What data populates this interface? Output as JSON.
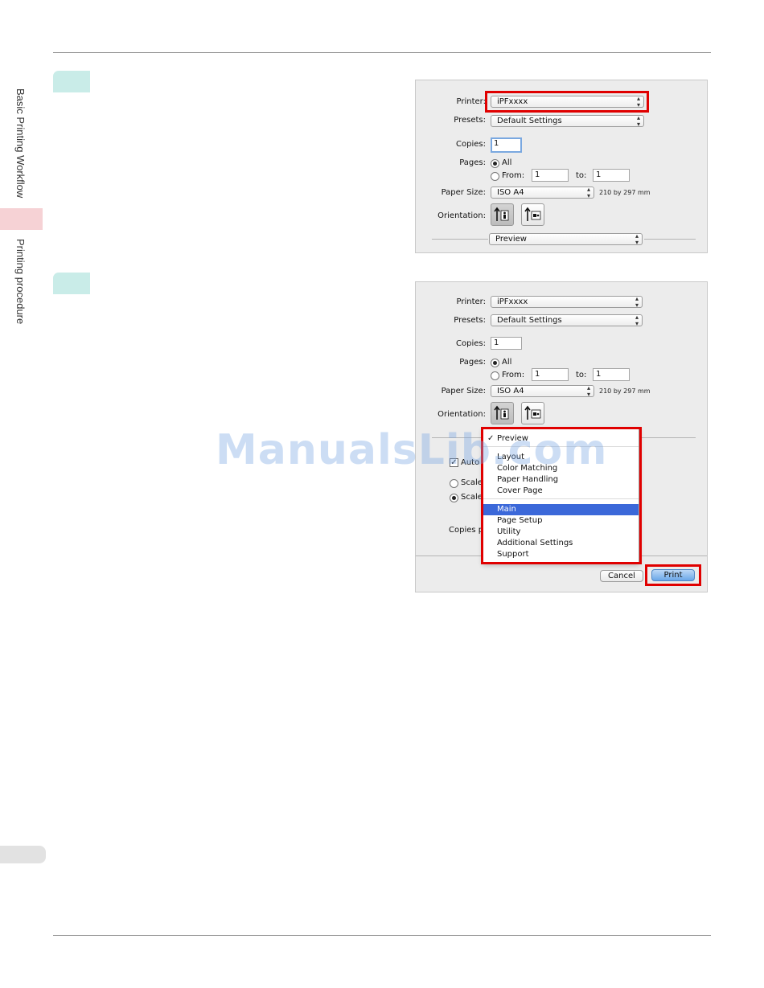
{
  "sidebar": {
    "section1": "Basic Printing Workflow",
    "section2": "Printing procedure"
  },
  "dialog1": {
    "printer_label": "Printer:",
    "printer_value": "iPFxxxx",
    "presets_label": "Presets:",
    "presets_value": "Default Settings",
    "copies_label": "Copies:",
    "copies_value": "1",
    "pages_label": "Pages:",
    "pages_all": "All",
    "pages_from": "From:",
    "pages_from_value": "1",
    "pages_to": "to:",
    "pages_to_value": "1",
    "paper_size_label": "Paper Size:",
    "paper_size_value": "ISO A4",
    "paper_size_dims": "210 by 297 mm",
    "orientation_label": "Orientation:",
    "panel_value": "Preview"
  },
  "dialog2": {
    "printer_label": "Printer:",
    "printer_value": "iPFxxxx",
    "presets_label": "Presets:",
    "presets_value": "Default Settings",
    "copies_label": "Copies:",
    "copies_value": "1",
    "pages_label": "Pages:",
    "pages_all": "All",
    "pages_from": "From:",
    "pages_from_value": "1",
    "pages_to": "to:",
    "pages_to_value": "1",
    "paper_size_label": "Paper Size:",
    "paper_size_value": "ISO A4",
    "paper_size_dims": "210 by 297 mm",
    "orientation_label": "Orientation:",
    "behind_auto": "Auto",
    "behind_scale1": "Scale",
    "behind_scale2": "Scale",
    "behind_copies": "Copies p",
    "cancel_label": "Cancel",
    "print_label": "Print",
    "menu": {
      "checkmark": "✓",
      "items": [
        "Preview",
        "Layout",
        "Color Matching",
        "Paper Handling",
        "Cover Page",
        "Main",
        "Page Setup",
        "Utility",
        "Additional Settings",
        "Support"
      ]
    }
  },
  "watermark": "ManualsLib.com",
  "colors": {
    "highlight": "#e00000",
    "menu_selection": "#3b68d9",
    "step_tab": "#c9ece8",
    "side_tab": "#f6d2d5"
  }
}
